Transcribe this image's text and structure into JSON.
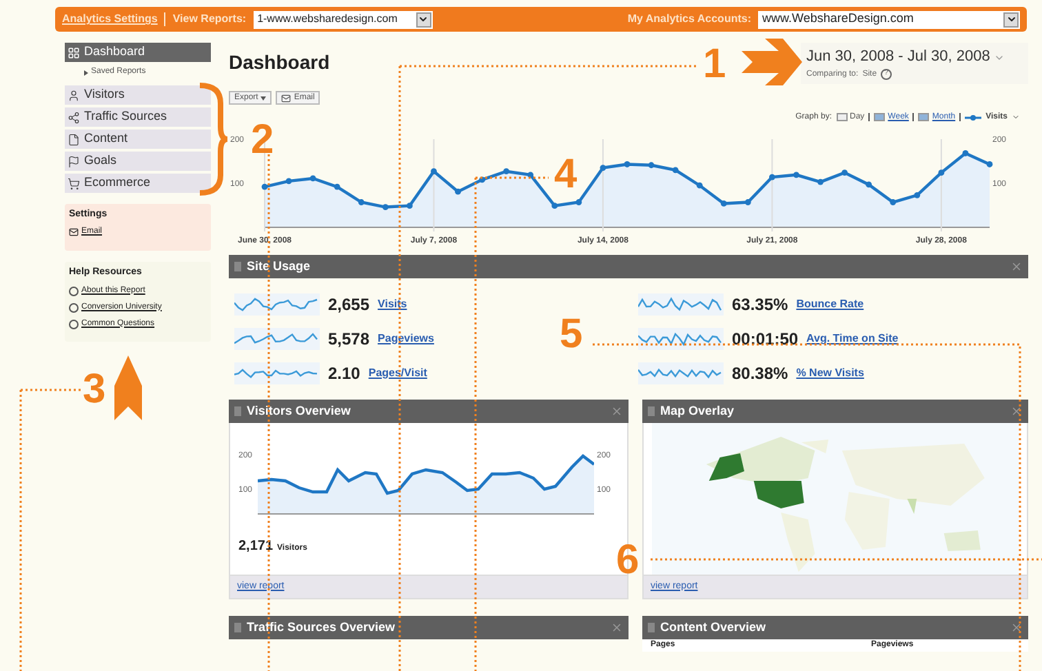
{
  "top_bar": {
    "settings_link": "Analytics Settings",
    "view_reports_label": "View Reports:",
    "view_reports_value": "1-www.websharedesign.com",
    "accounts_label": "My Analytics Accounts:",
    "accounts_value": "www.WebshareDesign.com"
  },
  "sidebar": {
    "items": [
      {
        "label": "Dashboard",
        "selected": true
      }
    ],
    "saved_reports": "Saved Reports",
    "sections": [
      {
        "label": "Visitors"
      },
      {
        "label": "Traffic Sources"
      },
      {
        "label": "Content"
      },
      {
        "label": "Goals"
      },
      {
        "label": "Ecommerce"
      }
    ],
    "settings": {
      "title": "Settings",
      "link": "Email"
    },
    "help": {
      "title": "Help Resources",
      "links": [
        "About this Report",
        "Conversion University",
        "Common Questions"
      ]
    }
  },
  "header": {
    "title": "Dashboard",
    "date_range": "Jun 30, 2008 - Jul 30, 2008",
    "comparing_label": "Comparing to:",
    "comparing_value": "Site",
    "help_mark": "?"
  },
  "toolbar": {
    "buttons": [
      "Export",
      "Email"
    ],
    "graph_by_label": "Graph by:",
    "graph_options": [
      {
        "label": "Day",
        "selected": true
      },
      {
        "label": "Week",
        "selected": false
      },
      {
        "label": "Month",
        "selected": false
      }
    ]
  },
  "main_chart": {
    "chart_data": {
      "type": "area",
      "grid": true,
      "categories": [
        "June 30, 2008",
        null,
        null,
        null,
        null,
        null,
        null,
        "July 7, 2008",
        null,
        null,
        null,
        null,
        null,
        null,
        "July 14, 2008",
        null,
        null,
        null,
        null,
        null,
        null,
        "July 21, 2008",
        null,
        null,
        null,
        null,
        null,
        null,
        "July 28, 2008",
        null,
        null
      ],
      "yticks": [
        100,
        200
      ],
      "y2ticks": [
        100,
        200
      ],
      "ylim": [
        0,
        200
      ],
      "y2lim": [
        0,
        200
      ],
      "series": [
        {
          "name": "Visits",
          "color": "#1f77c4",
          "marker": "circle",
          "values": [
            92,
            105,
            111,
            92,
            57,
            46,
            49,
            127,
            81,
            108,
            127,
            119,
            49,
            57,
            135,
            143,
            141,
            130,
            95,
            54,
            57,
            114,
            119,
            103,
            124,
            97,
            57,
            73,
            124,
            168,
            143
          ]
        }
      ]
    }
  },
  "site_usage": {
    "title": "Site Usage",
    "metrics": [
      {
        "value": "2,655",
        "label": "Visits"
      },
      {
        "value": "5,578",
        "label": "Pageviews"
      },
      {
        "value": "2.10",
        "label": "Pages/Visit"
      },
      {
        "value": "63.35%",
        "label": "Bounce Rate"
      },
      {
        "value": "00:01:50",
        "label": "Avg. Time on Site"
      },
      {
        "value": "80.38%",
        "label": "% New Visits"
      }
    ]
  },
  "visitors_overview": {
    "title": "Visitors Overview",
    "chart": {
      "kind": "picture",
      "left_ticks": [
        "200",
        "100"
      ],
      "right_ticks": [
        "200",
        "100"
      ]
    },
    "total": "2,171",
    "total_label": "Visitors",
    "link": "view report"
  },
  "map_overlay": {
    "title": "Map Overlay",
    "link": "view report"
  },
  "traffic_sources_overview": {
    "title": "Traffic Sources Overview"
  },
  "content_overview": {
    "title": "Content Overview",
    "columns": [
      "Pages",
      "Pageviews"
    ]
  },
  "annotations": [
    "1",
    "2",
    "3",
    "4",
    "5",
    "6"
  ]
}
